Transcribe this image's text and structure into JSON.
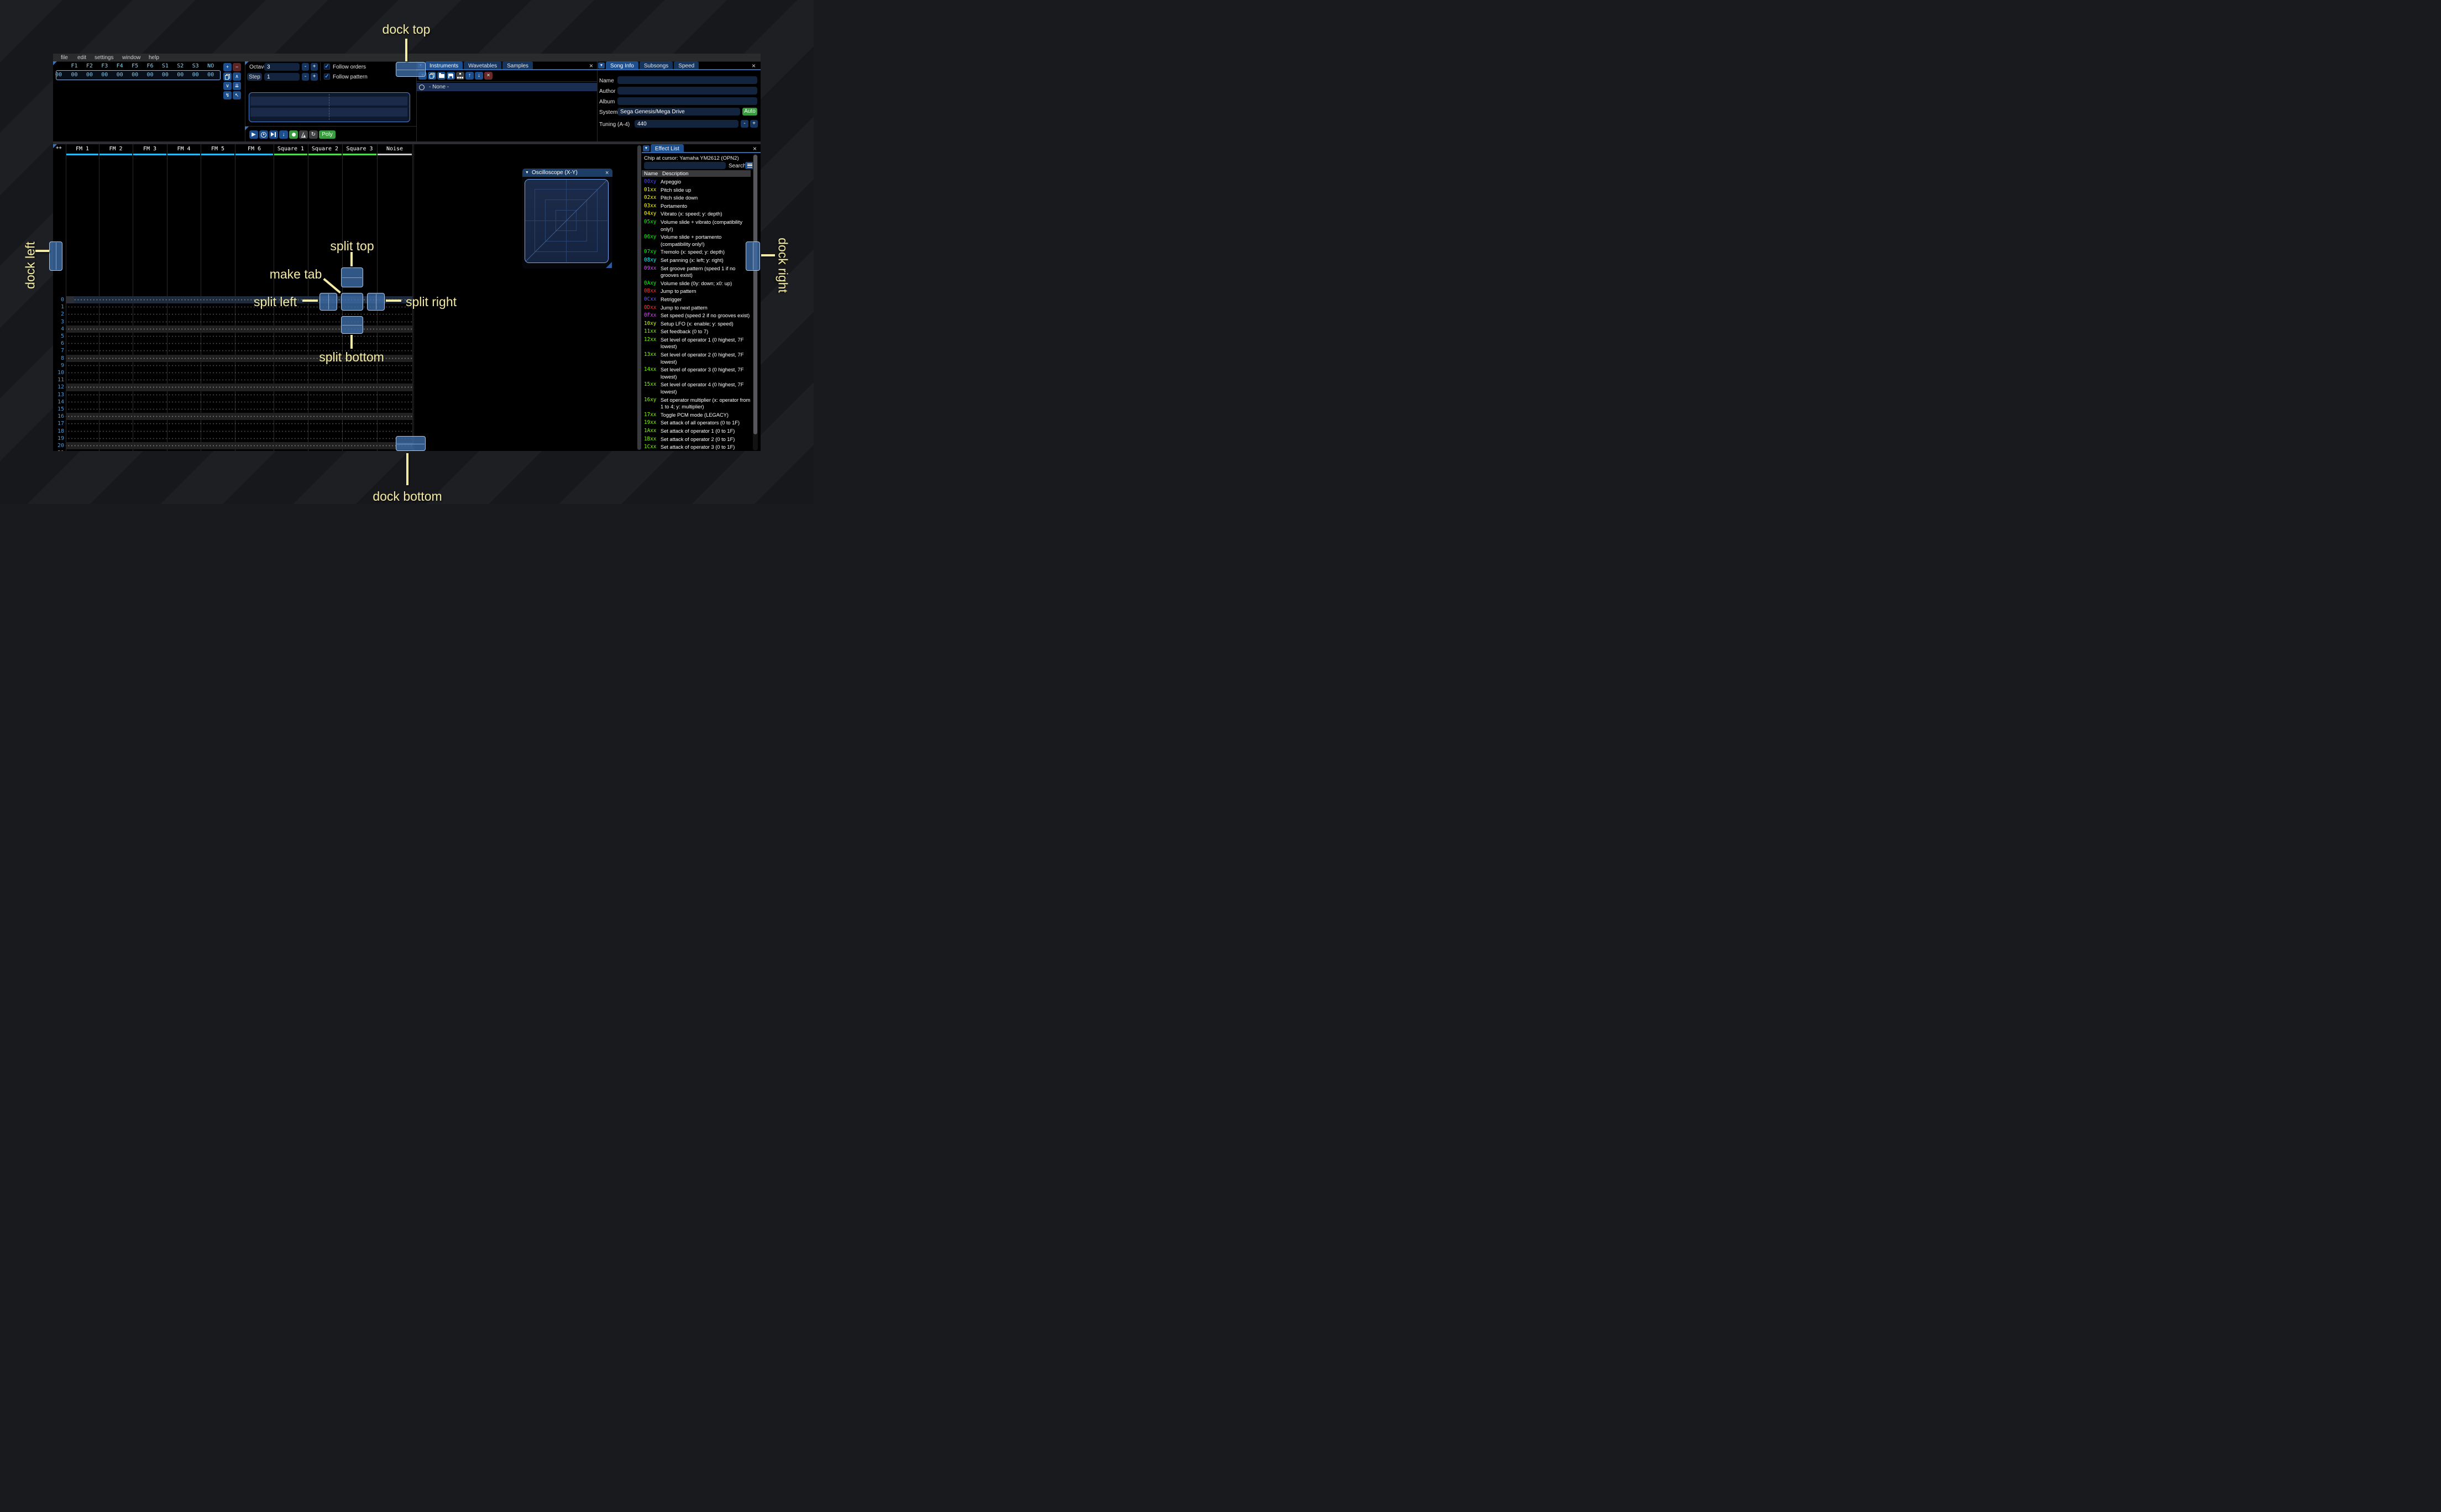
{
  "menu": {
    "items": [
      "file",
      "edit",
      "settings",
      "window",
      "help"
    ]
  },
  "orders": {
    "header": [
      "F1",
      "F2",
      "F3",
      "F4",
      "F5",
      "F6",
      "S1",
      "S2",
      "S3",
      "NO"
    ],
    "row_index": "00",
    "row_values": [
      "00",
      "00",
      "00",
      "00",
      "00",
      "00",
      "00",
      "00",
      "00",
      "00"
    ],
    "buttons": [
      {
        "name": "order-add-button",
        "icon": "plus-icon",
        "glyph": "+",
        "style": "blue"
      },
      {
        "name": "order-remove-button",
        "icon": "minus-icon",
        "glyph": "−",
        "style": "maroon"
      },
      {
        "name": "order-duplicate-button",
        "icon": "copy-icon",
        "glyph": "",
        "style": "blue"
      },
      {
        "name": "order-move-up-button",
        "icon": "chevron-up-icon",
        "glyph": "∧",
        "style": "blue"
      },
      {
        "name": "order-move-down-button",
        "icon": "chevron-down-icon",
        "glyph": "∨",
        "style": "blue"
      },
      {
        "name": "order-duplicate-end-button",
        "icon": "double-down-icon",
        "glyph": "⇊",
        "style": "blue"
      },
      {
        "name": "order-deep-clone-button",
        "icon": "break-link-icon",
        "glyph": "↯",
        "style": "blue"
      },
      {
        "name": "order-edit-mode-button",
        "icon": "cursor-icon",
        "glyph": "↖",
        "style": "blue"
      }
    ]
  },
  "controls": {
    "octave_label": "Octave",
    "octave_value": "3",
    "step_label": "Step",
    "step_value": "1",
    "minus_label": "-",
    "plus_label": "+",
    "follow_orders_label": "Follow orders",
    "follow_orders_checked": "✓",
    "follow_pattern_label": "Follow pattern",
    "follow_pattern_checked": "✓",
    "poly_label": "Poly"
  },
  "transport": {
    "buttons": [
      {
        "name": "play-button",
        "icon": "play-icon",
        "style": "blue"
      },
      {
        "name": "play-from-start-button",
        "icon": "play-circle-icon",
        "style": "blue"
      },
      {
        "name": "play-one-row-button",
        "icon": "step-play-icon",
        "style": "blue"
      },
      {
        "name": "step-row-button",
        "icon": "arrow-down-icon",
        "style": "blue"
      },
      {
        "name": "stop-button",
        "icon": "record-circle-icon",
        "style": "green"
      },
      {
        "name": "metronome-button",
        "icon": "metronome-icon",
        "style": "gray"
      },
      {
        "name": "repeat-pattern-button",
        "icon": "repeat-icon",
        "style": "gray"
      }
    ]
  },
  "instruments": {
    "tabs": [
      {
        "label": "Instruments"
      },
      {
        "label": "Wavetables"
      },
      {
        "label": "Samples"
      }
    ],
    "active_tab": "Instruments",
    "toolbar": [
      {
        "name": "instrument-add-button",
        "icon": "plus-icon",
        "style": "blue"
      },
      {
        "name": "instrument-duplicate-button",
        "icon": "copy-icon",
        "style": "blue"
      },
      {
        "name": "instrument-open-button",
        "icon": "folder-open-icon",
        "style": "blue"
      },
      {
        "name": "instrument-save-button",
        "icon": "save-icon",
        "style": "blue"
      },
      {
        "name": "instrument-organize-button",
        "icon": "organize-icon",
        "style": "gray"
      },
      {
        "name": "instrument-move-up-button",
        "icon": "arrow-up-icon",
        "style": "blue"
      },
      {
        "name": "instrument-move-down-button",
        "icon": "arrow-down-icon",
        "style": "blue"
      },
      {
        "name": "instrument-delete-button",
        "icon": "delete-icon",
        "style": "red"
      }
    ],
    "list": [
      {
        "label": "- None -",
        "selected": true
      }
    ]
  },
  "song_info": {
    "tabs": [
      {
        "label": "Song Info"
      },
      {
        "label": "Subsongs"
      },
      {
        "label": "Speed"
      }
    ],
    "active_tab": "Song Info",
    "name_label": "Name",
    "name_value": "",
    "author_label": "Author",
    "author_value": "",
    "album_label": "Album",
    "album_value": "",
    "system_label": "System",
    "system_value": "Sega Genesis/Mega Drive",
    "auto_label": "Auto",
    "tuning_label": "Tuning (A-4)",
    "tuning_value": "440"
  },
  "pattern": {
    "corner_label": "++",
    "channels": [
      {
        "label": "FM 1",
        "color": "#2ab7f2"
      },
      {
        "label": "FM 2",
        "color": "#2ab7f2"
      },
      {
        "label": "FM 3",
        "color": "#2ab7f2"
      },
      {
        "label": "FM 4",
        "color": "#2ab7f2"
      },
      {
        "label": "FM 5",
        "color": "#2ab7f2"
      },
      {
        "label": "FM 6",
        "color": "#2ab7f2"
      },
      {
        "label": "Square 1",
        "color": "#52d94e"
      },
      {
        "label": "Square 2",
        "color": "#52d94e"
      },
      {
        "label": "Square 3",
        "color": "#52d94e"
      },
      {
        "label": "Noise",
        "color": "#c9c9c9"
      }
    ],
    "row_count": 22,
    "highlight_every": 4,
    "cursor_row": 0
  },
  "oscilloscope": {
    "title": "Oscilloscope (X-Y)"
  },
  "effect_list": {
    "tab_label": "Effect List",
    "chip_label": "Chip at cursor: Yamaha YM2612 (OPN2)",
    "search_label": "Search",
    "search_value": "",
    "columns": [
      "Name",
      "Description"
    ],
    "effects": [
      {
        "code": "00xy",
        "color": "#4444ff",
        "desc": "Arpeggio"
      },
      {
        "code": "01xx",
        "color": "#ffff00",
        "desc": "Pitch slide up"
      },
      {
        "code": "02xx",
        "color": "#ffff00",
        "desc": "Pitch slide down"
      },
      {
        "code": "03xx",
        "color": "#ffff00",
        "desc": "Portamento"
      },
      {
        "code": "04xy",
        "color": "#ffff00",
        "desc": "Vibrato (x: speed; y: depth)"
      },
      {
        "code": "05xy",
        "color": "#00ff00",
        "desc": "Volume slide + vibrato (compatibility only!)"
      },
      {
        "code": "06xy",
        "color": "#00ff00",
        "desc": "Volume slide + portamento (compatibility only!)"
      },
      {
        "code": "07xy",
        "color": "#00ff00",
        "desc": "Tremolo (x: speed; y: depth)"
      },
      {
        "code": "08xy",
        "color": "#00ffff",
        "desc": "Set panning (x: left; y: right)"
      },
      {
        "code": "09xx",
        "color": "#d94dff",
        "desc": "Set groove pattern (speed 1 if no grooves exist)"
      },
      {
        "code": "0Axy",
        "color": "#00ff00",
        "desc": "Volume slide (0y: down; x0: up)"
      },
      {
        "code": "0Bxx",
        "color": "#ff3333",
        "desc": "Jump to pattern"
      },
      {
        "code": "0Cxx",
        "color": "#6a4fff",
        "desc": "Retrigger"
      },
      {
        "code": "0Dxx",
        "color": "#ff3333",
        "desc": "Jump to next pattern"
      },
      {
        "code": "0Fxx",
        "color": "#d94dff",
        "desc": "Set speed (speed 2 if no grooves exist)"
      },
      {
        "code": "10xy",
        "color": "#ccff00",
        "desc": "Setup LFO (x: enable; y: speed)"
      },
      {
        "code": "11xx",
        "color": "#80ff00",
        "desc": "Set feedback (0 to 7)"
      },
      {
        "code": "12xx",
        "color": "#80ff00",
        "desc": "Set level of operator 1 (0 highest, 7F lowest)"
      },
      {
        "code": "13xx",
        "color": "#80ff00",
        "desc": "Set level of operator 2 (0 highest, 7F lowest)"
      },
      {
        "code": "14xx",
        "color": "#80ff00",
        "desc": "Set level of operator 3 (0 highest, 7F lowest)"
      },
      {
        "code": "15xx",
        "color": "#80ff00",
        "desc": "Set level of operator 4 (0 highest, 7F lowest)"
      },
      {
        "code": "16xy",
        "color": "#80ff00",
        "desc": "Set operator multiplier (x: operator from 1 to 4; y: multiplier)"
      },
      {
        "code": "17xx",
        "color": "#80ff00",
        "desc": "Toggle PCM mode (LEGACY)"
      },
      {
        "code": "19xx",
        "color": "#80ff00",
        "desc": "Set attack of all operators (0 to 1F)"
      },
      {
        "code": "1Axx",
        "color": "#80ff00",
        "desc": "Set attack of operator 1 (0 to 1F)"
      },
      {
        "code": "1Bxx",
        "color": "#80ff00",
        "desc": "Set attack of operator 2 (0 to 1F)"
      },
      {
        "code": "1Cxx",
        "color": "#80ff00",
        "desc": "Set attack of operator 3 (0 to 1F)"
      }
    ]
  },
  "overlay": {
    "dock_top": "dock top",
    "dock_bottom": "dock bottom",
    "dock_left": "dock left",
    "dock_right": "dock right",
    "split_top": "split top",
    "split_bottom": "split bottom",
    "split_left": "split left",
    "split_right": "split right",
    "make_tab": "make tab"
  },
  "colors": {
    "accent_blue": "#1d4e8d",
    "accent_green": "#3a9b3f",
    "overlay_label": "#f3eba6",
    "orders_text": "#8ad2f2",
    "row_number": "#4d9fdf"
  }
}
